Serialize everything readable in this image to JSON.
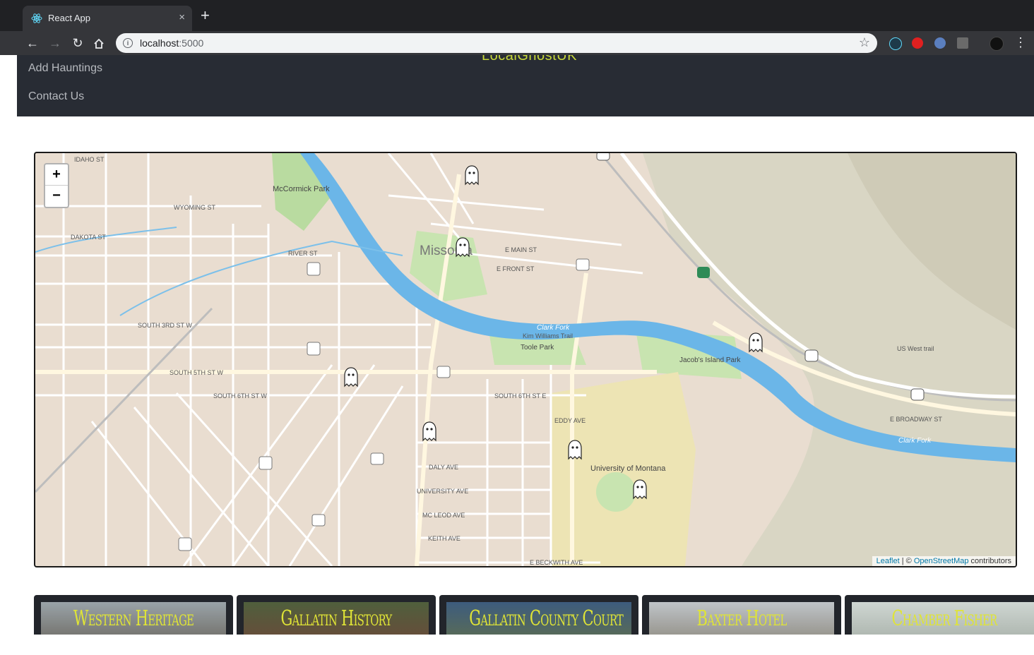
{
  "browser": {
    "tab_title": "React App",
    "tab_close": "×",
    "new_tab": "+",
    "url_host": "localhost",
    "url_port": ":5000"
  },
  "app": {
    "brand": "LocalGhostUK",
    "nav": [
      {
        "label": "Add Hauntings"
      },
      {
        "label": "Contact Us"
      }
    ]
  },
  "map": {
    "zoom_in": "+",
    "zoom_out": "−",
    "attribution": {
      "leaflet": "Leaflet",
      "sep": " | © ",
      "osm": "OpenStreetMap",
      "suffix": " contributors"
    },
    "labels": {
      "city": "Missoula",
      "clark_fork": "Clark Fork",
      "mccormick": "McCormick Park",
      "toole": "Toole Park",
      "jacobs": "Jacob's Island Park",
      "university": "University of Montana",
      "s3rd": "SOUTH 3RD ST W",
      "s5th": "SOUTH 5TH ST W",
      "s6th": "SOUTH 6TH ST W",
      "s6the": "SOUTH 6TH ST E",
      "broadway": "E BROADWAY ST",
      "front": "E FRONT ST",
      "main": "E MAIN ST",
      "wyoming": "WYOMING ST",
      "dakota": "DAKOTA ST",
      "river": "RIVER ST",
      "idaho": "IDAHO ST",
      "eddy": "EDDY AVE",
      "daly": "DALY AVE",
      "univ_ave": "UNIVERSITY AVE",
      "mcleod": "MC LEOD AVE",
      "keith": "KEITH AVE",
      "beckwith": "E BECKWITH AVE",
      "kim_williams": "Kim Williams Trail",
      "us_west": "US West trail"
    },
    "accent_river": "#6bb6e8"
  },
  "cards": [
    {
      "title": "Western Heritage"
    },
    {
      "title": "Gallatin History"
    },
    {
      "title": "Gallatin County Court"
    },
    {
      "title": "Baxter Hotel"
    },
    {
      "title": "Chamber Fisher"
    }
  ]
}
